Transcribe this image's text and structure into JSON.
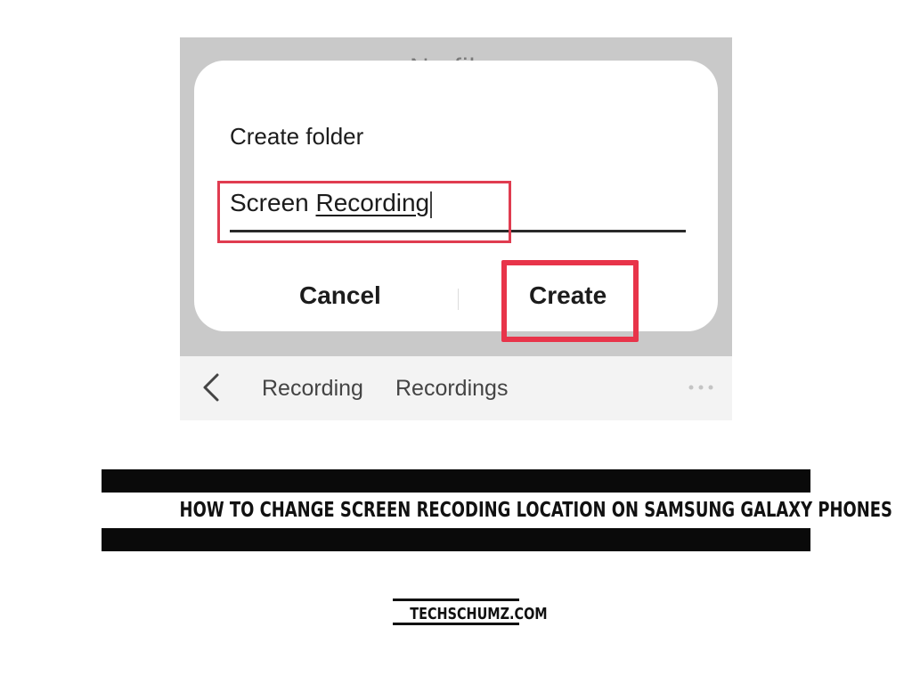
{
  "dialog": {
    "title": "Create folder",
    "input_value_plain": "Screen ",
    "input_value_underlined": "Recording",
    "cancel_label": "Cancel",
    "create_label": "Create"
  },
  "background": {
    "partial_title": "No fil"
  },
  "pathbar": {
    "crumbs": [
      "Recording",
      "Recordings"
    ]
  },
  "caption": {
    "headline": "HOW TO CHANGE SCREEN RECODING LOCATION ON SAMSUNG GALAXY PHONES",
    "site": "TECHSCHUMZ.COM"
  },
  "colors": {
    "highlight": "#e8344a",
    "overlay": "#c9c9c9",
    "banner": "#0a0a0a"
  },
  "icons": {
    "back": "chevron-left-icon",
    "more": "more-horizontal-icon"
  }
}
